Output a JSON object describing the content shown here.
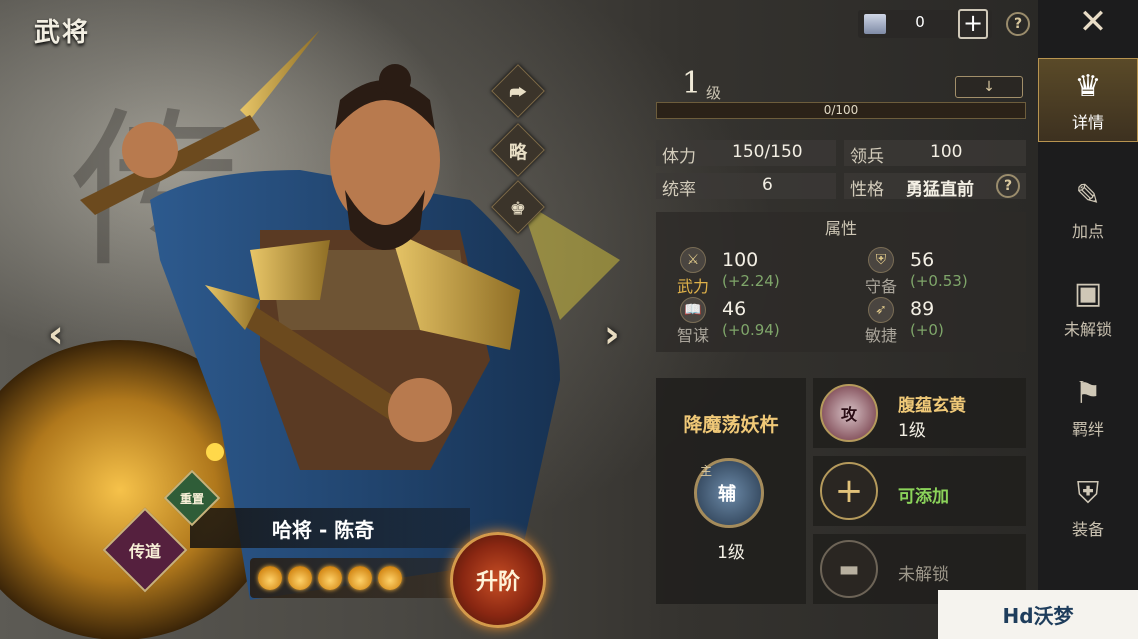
{
  "header": {
    "title": "武将"
  },
  "topbar": {
    "coins": "0",
    "plus": "+",
    "help": "?"
  },
  "hero_actions": [
    {
      "label": "⮫"
    },
    {
      "label": "略"
    },
    {
      "label": "♚"
    }
  ],
  "hero": {
    "name": "哈将 - 陈奇",
    "rank_top": "重置",
    "rank_main": "传道",
    "upgrade": "升阶",
    "stars": 5
  },
  "sidebar": {
    "close": "✕",
    "items": [
      {
        "label": "详情",
        "icon": "♛"
      },
      {
        "label": "加点",
        "icon": "✎"
      },
      {
        "label": "未解锁",
        "icon": "▣"
      },
      {
        "label": "羁绊",
        "icon": "⚑"
      },
      {
        "label": "装备",
        "icon": "⛨"
      }
    ]
  },
  "level": {
    "value": "1",
    "label": "级",
    "button": "↓",
    "xp": "0/100",
    "progress": 0
  },
  "stats": {
    "hp_label": "体力",
    "hp_value": "150/150",
    "troops_label": "领兵",
    "troops_value": "100",
    "command_label": "统率",
    "command_value": "6",
    "personality_label": "性格",
    "personality_value": "勇猛直前",
    "help": "?"
  },
  "attributes": {
    "title": "属性",
    "items": [
      {
        "name": "武力",
        "value": "100",
        "bonus": "(+2.24)",
        "icon": "⚔"
      },
      {
        "name": "守备",
        "value": "56",
        "bonus": "(+0.53)",
        "icon": "⛨"
      },
      {
        "name": "智谋",
        "value": "46",
        "bonus": "(+0.94)",
        "icon": "📖"
      },
      {
        "name": "敏捷",
        "value": "89",
        "bonus": "(+0)",
        "icon": "➶"
      }
    ]
  },
  "weapon": {
    "name": "降魔荡妖杵",
    "badge": "辅",
    "sub": "主",
    "level": "1级"
  },
  "skills": [
    {
      "name": "腹蕴玄黄",
      "level": "1级",
      "badge": "攻"
    },
    {
      "name": "可添加",
      "icon": "+"
    },
    {
      "name": "未解锁",
      "icon": "▬"
    }
  ],
  "watermark": {
    "text": "Hd沃梦"
  },
  "colors": {
    "accent": "#c9a55c",
    "bonus": "#7fa66a",
    "add": "#8bd35a"
  }
}
